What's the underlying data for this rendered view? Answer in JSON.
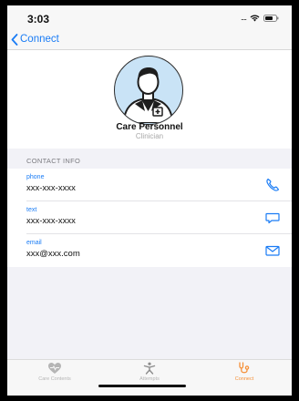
{
  "status_bar": {
    "time": "3:03",
    "signal": "....",
    "icons": [
      "signal-dots",
      "wifi-icon",
      "battery-icon"
    ]
  },
  "nav": {
    "back_label": "Connect"
  },
  "profile": {
    "name": "Care Personnel",
    "role": "Clinician",
    "avatar_icon": "doctor-avatar-icon"
  },
  "contact_info": {
    "title": "CONTACT INFO",
    "items": [
      {
        "label": "phone",
        "value": "xxx-xxx-xxxx",
        "icon": "phone-icon"
      },
      {
        "label": "text",
        "value": "xxx-xxx-xxxx",
        "icon": "message-icon"
      },
      {
        "label": "email",
        "value": "xxx@xxx.com",
        "icon": "mail-icon"
      }
    ]
  },
  "tabs": [
    {
      "label": "Care Contents",
      "icon": "heart-icon",
      "active": false
    },
    {
      "label": "Attempts",
      "icon": "person-icon",
      "active": false
    },
    {
      "label": "Connect",
      "icon": "stethoscope-icon",
      "active": true
    }
  ],
  "colors": {
    "accent": "#1a7cf5",
    "tab_active": "#f5913a",
    "tab_inactive": "#b5b5b5",
    "avatar_bg": "#c9e3f6"
  }
}
